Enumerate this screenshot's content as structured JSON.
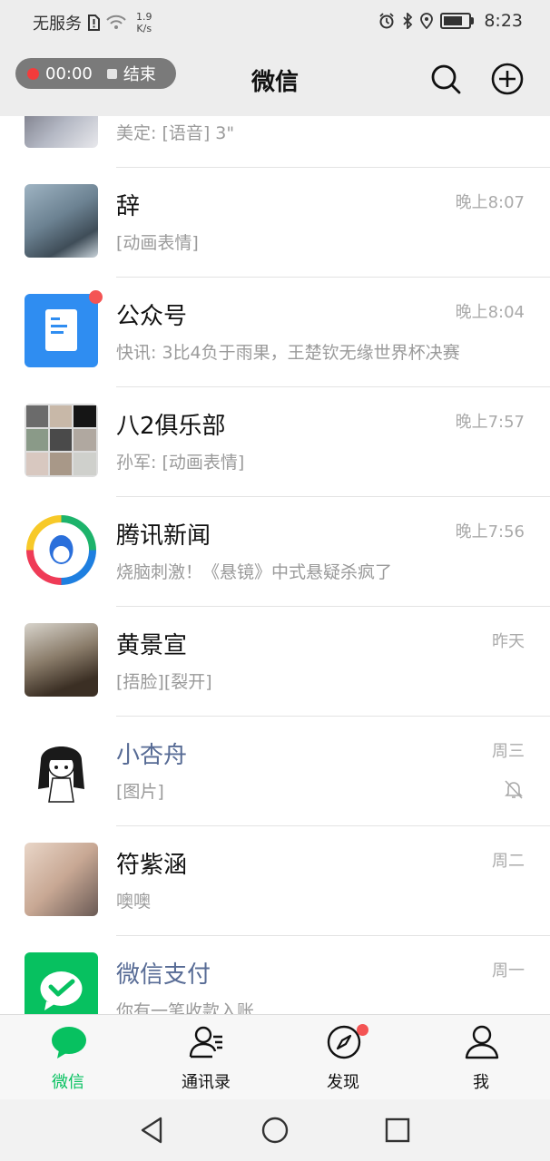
{
  "status_bar": {
    "carrier": "无服务",
    "net_speed_value": "1.9",
    "net_speed_unit": "K/s",
    "time": "8:23",
    "icons": [
      "sim-alert-icon",
      "wifi-icon",
      "alarm-icon",
      "bluetooth-icon",
      "location-icon",
      "battery-icon"
    ]
  },
  "recording": {
    "elapsed": "00:00",
    "end_label": "结束"
  },
  "header": {
    "title": "微信"
  },
  "chats": [
    {
      "name": "",
      "preview": "美定: [语音] 3\"",
      "time": ""
    },
    {
      "name": "辞",
      "preview": "[动画表情]",
      "time": "晚上8:07"
    },
    {
      "name": "公众号",
      "preview": "快讯: 3比4负于雨果，王楚钦无缘世界杯决赛",
      "time": "晚上8:04",
      "unread": true
    },
    {
      "name": "八2俱乐部",
      "preview": "孙军: [动画表情]",
      "time": "晚上7:57"
    },
    {
      "name": "腾讯新闻",
      "preview": "烧脑刺激！《悬镜》中式悬疑杀疯了",
      "time": "晚上7:56"
    },
    {
      "name": "黄景宣",
      "preview": "[捂脸][裂开]",
      "time": "昨天"
    },
    {
      "name": "小杏舟",
      "preview": "[图片]",
      "time": "周三",
      "muted": true
    },
    {
      "name": "符紫涵",
      "preview": "噢噢",
      "time": "周二"
    },
    {
      "name": "微信支付",
      "preview": "你有一笔收款入账",
      "time": "周一"
    }
  ],
  "tabs": [
    {
      "label": "微信",
      "active": true
    },
    {
      "label": "通讯录"
    },
    {
      "label": "发现",
      "badge": true
    },
    {
      "label": "我"
    }
  ],
  "colors": {
    "accent": "#07c160",
    "badge": "#f45454",
    "link_name": "#576b95",
    "recording_dot": "#f23c3c"
  }
}
